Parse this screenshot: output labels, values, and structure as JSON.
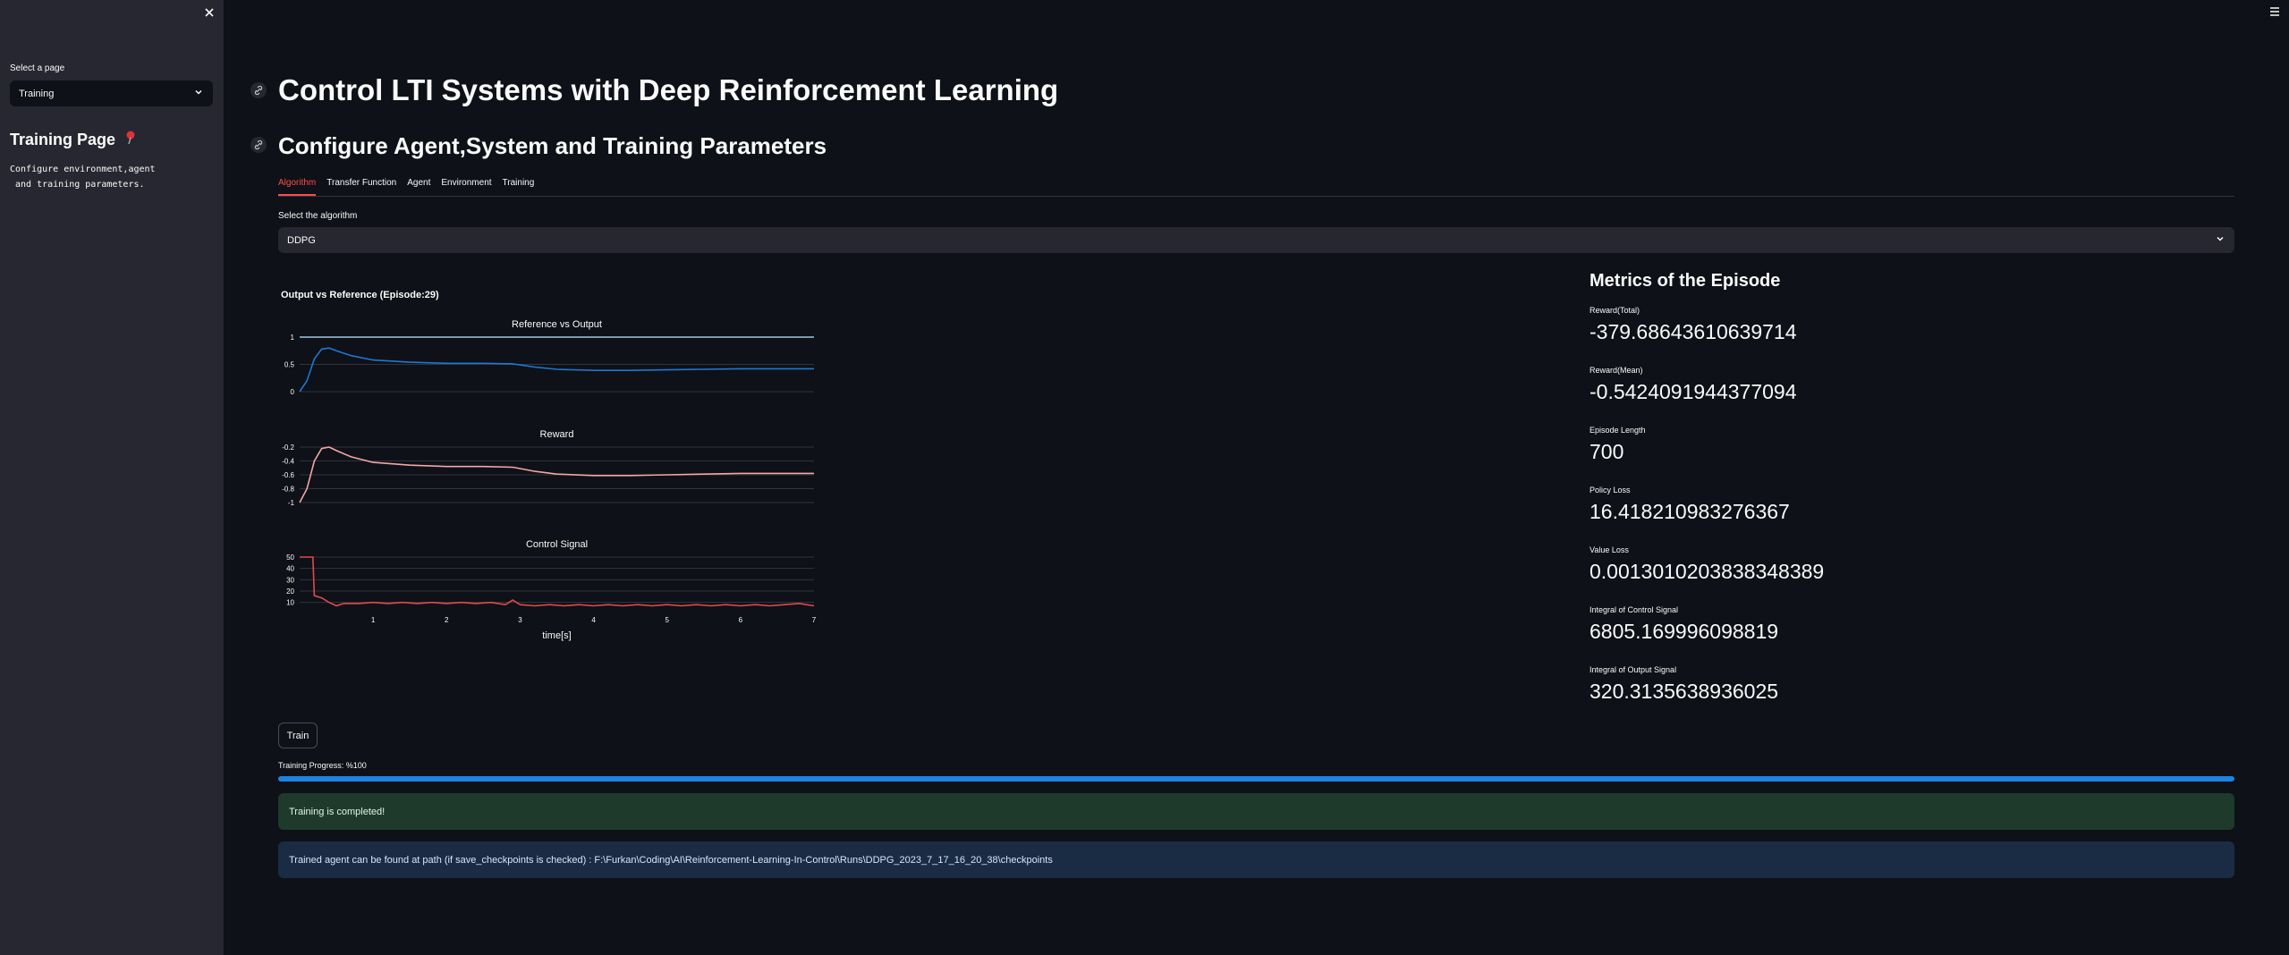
{
  "sidebar": {
    "select_label": "Select a page",
    "select_value": "Training",
    "title": "Training Page",
    "title_icon": "pushpin-icon",
    "description": "Configure environment,agent\n and training parameters."
  },
  "main": {
    "title": "Control LTI Systems with Deep Reinforcement Learning",
    "subtitle": "Configure Agent,System and Training Parameters",
    "tabs": [
      "Algorithm",
      "Transfer Function",
      "Agent",
      "Environment",
      "Training"
    ],
    "active_tab": "Algorithm",
    "algorithm_label": "Select the algorithm",
    "algorithm_value": "DDPG"
  },
  "chart_header": "Output vs Reference (Episode:29)",
  "chart_data": [
    {
      "type": "line",
      "title": "Reference vs Output",
      "xlim": [
        0,
        7
      ],
      "ylim": [
        0,
        1
      ],
      "yticks": [
        "0",
        "0.5",
        "1"
      ],
      "series": [
        {
          "color": "#9ecae1",
          "x": [
            0,
            7
          ],
          "y": [
            1,
            1
          ]
        },
        {
          "color": "#1f77d4",
          "x": [
            0,
            0.1,
            0.2,
            0.3,
            0.4,
            0.5,
            0.7,
            1.0,
            1.5,
            2.0,
            2.5,
            2.9,
            3.0,
            3.2,
            3.5,
            4.0,
            4.5,
            5.0,
            5.5,
            6.0,
            6.5,
            7.0
          ],
          "y": [
            0,
            0.2,
            0.6,
            0.78,
            0.8,
            0.75,
            0.66,
            0.58,
            0.54,
            0.52,
            0.52,
            0.51,
            0.49,
            0.45,
            0.41,
            0.39,
            0.39,
            0.4,
            0.41,
            0.42,
            0.42,
            0.42
          ]
        }
      ]
    },
    {
      "type": "line",
      "title": "Reward",
      "xlim": [
        0,
        7
      ],
      "ylim": [
        -1,
        -0.2
      ],
      "yticks": [
        "-0.2",
        "-0.4",
        "-0.6",
        "-0.8",
        "-1"
      ],
      "series": [
        {
          "color": "#f4a6a6",
          "x": [
            0,
            0.1,
            0.2,
            0.3,
            0.4,
            0.5,
            0.7,
            1.0,
            1.5,
            2.0,
            2.5,
            2.9,
            3.0,
            3.2,
            3.5,
            4.0,
            4.5,
            5.0,
            5.5,
            6.0,
            6.5,
            7.0
          ],
          "y": [
            -1,
            -0.8,
            -0.4,
            -0.22,
            -0.2,
            -0.25,
            -0.34,
            -0.42,
            -0.46,
            -0.48,
            -0.48,
            -0.49,
            -0.51,
            -0.55,
            -0.59,
            -0.61,
            -0.61,
            -0.6,
            -0.59,
            -0.58,
            -0.58,
            -0.58
          ]
        }
      ]
    },
    {
      "type": "line",
      "title": "Control Signal",
      "xlabel": "time[s]",
      "xlim": [
        0,
        7
      ],
      "ylim": [
        5,
        50
      ],
      "xticks": [
        "1",
        "2",
        "3",
        "4",
        "5",
        "6",
        "7"
      ],
      "yticks": [
        "50",
        "40",
        "30",
        "20",
        "10"
      ],
      "series": [
        {
          "color": "#e04a4a",
          "x": [
            0,
            0.05,
            0.18,
            0.2,
            0.3,
            0.4,
            0.5,
            0.6,
            0.8,
            1.0,
            1.2,
            1.4,
            1.6,
            1.8,
            2.0,
            2.2,
            2.4,
            2.6,
            2.8,
            2.9,
            3.0,
            3.2,
            3.4,
            3.6,
            3.8,
            4.0,
            4.2,
            4.4,
            4.6,
            4.8,
            5.0,
            5.2,
            5.4,
            5.6,
            5.8,
            6.0,
            6.2,
            6.4,
            6.6,
            6.8,
            7.0
          ],
          "y": [
            50,
            50,
            50,
            16,
            14,
            10,
            7,
            9,
            9,
            10,
            9,
            10,
            9,
            10,
            9,
            10,
            9,
            10,
            8,
            12,
            8,
            7,
            8,
            7,
            8,
            7,
            8,
            7,
            8,
            7,
            8,
            7,
            8,
            7,
            8,
            7,
            8,
            7,
            8,
            9,
            7
          ]
        }
      ]
    }
  ],
  "metrics": {
    "title": "Metrics of the Episode",
    "items": [
      {
        "label": "Reward(Total)",
        "value": "-379.68643610639714"
      },
      {
        "label": "Reward(Mean)",
        "value": "-0.5424091944377094"
      },
      {
        "label": "Episode Length",
        "value": "700"
      },
      {
        "label": "Policy Loss",
        "value": "16.418210983276367"
      },
      {
        "label": "Value Loss",
        "value": "0.0013010203838348389"
      },
      {
        "label": "Integral of Control Signal",
        "value": "6805.169996098819"
      },
      {
        "label": "Integral of Output Signal",
        "value": "320.3135638936025"
      }
    ]
  },
  "train": {
    "button_label": "Train",
    "progress_text": "Training Progress: %100",
    "progress_value": 1.0,
    "progress_color": "#1c83e1"
  },
  "alerts": {
    "success": "Training is completed!",
    "info": "Trained agent can be found at path (if save_checkpoints is checked) : F:\\Furkan\\Coding\\AI\\Reinforcement-Learning-In-Control\\Runs\\DDPG_2023_7_17_16_20_38\\checkpoints"
  },
  "colors": {
    "background": "#0e1117",
    "sidebar": "#262730",
    "accent": "#ff4b4b",
    "success_bg": "#1e3a2b",
    "info_bg": "#1a2c44"
  }
}
